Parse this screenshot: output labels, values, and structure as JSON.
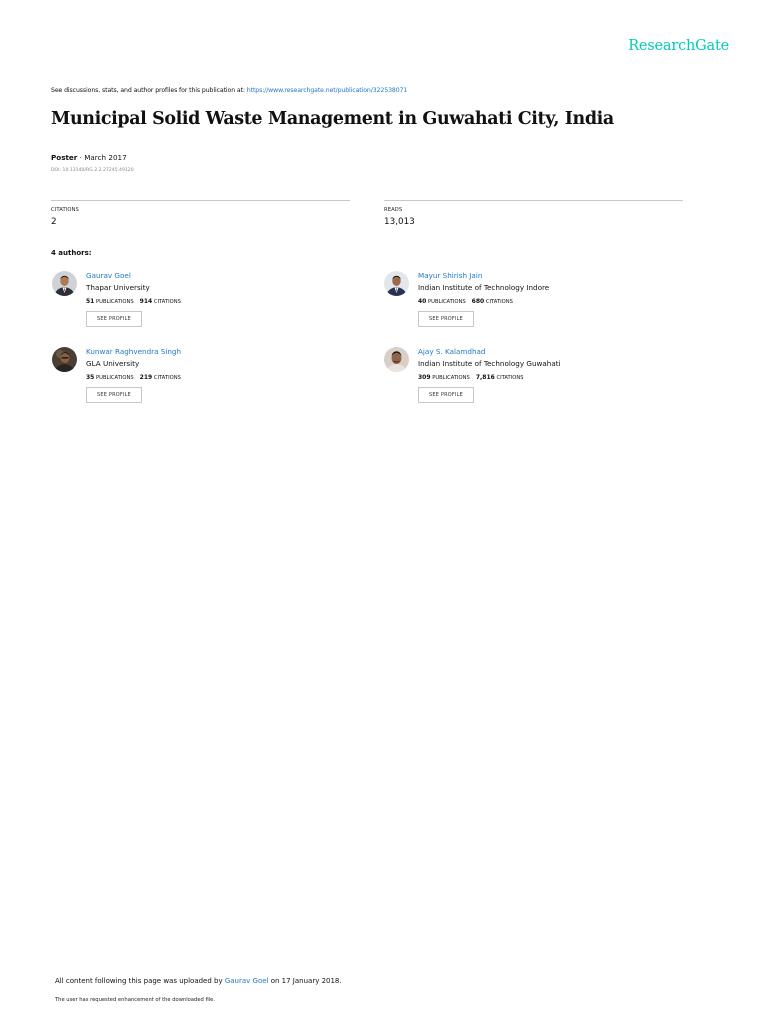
{
  "logo": "ResearchGate",
  "intro": {
    "text": "See discussions, stats, and author profiles for this publication at: ",
    "link": "https://www.researchgate.net/publication/322538071"
  },
  "publication": {
    "title": "Municipal Solid Waste Management in Guwahati City, India",
    "type": "Poster",
    "date": " · March 2017",
    "doi": "DOI: 10.13140/RG.2.2.27245.49120"
  },
  "stats": {
    "citations": {
      "label": "CITATIONS",
      "value": "2"
    },
    "reads": {
      "label": "READS",
      "value": "13,013"
    }
  },
  "authors_heading": "4 authors:",
  "authors": [
    {
      "name": "Gaurav Goel",
      "institution": "Thapar University",
      "publications": "51",
      "publications_label": "PUBLICATIONS",
      "citations": "914",
      "citations_label": "CITATIONS",
      "button": "SEE PROFILE"
    },
    {
      "name": "Mayur Shirish Jain",
      "institution": "Indian Institute of Technology Indore",
      "publications": "40",
      "publications_label": "PUBLICATIONS",
      "citations": "680",
      "citations_label": "CITATIONS",
      "button": "SEE PROFILE"
    },
    {
      "name": "Kunwar Raghvendra Singh",
      "institution": "GLA University",
      "publications": "35",
      "publications_label": "PUBLICATIONS",
      "citations": "219",
      "citations_label": "CITATIONS",
      "button": "SEE PROFILE"
    },
    {
      "name": "Ajay S. Kalamdhad",
      "institution": "Indian Institute of Technology Guwahati",
      "publications": "309",
      "publications_label": "PUBLICATIONS",
      "citations": "7,816",
      "citations_label": "CITATIONS",
      "button": "SEE PROFILE"
    }
  ],
  "footer": {
    "prefix": "All content following this page was uploaded by ",
    "uploader": "Gaurav Goel",
    "suffix": " on 17 January 2018.",
    "note": "The user has requested enhancement of the downloaded file."
  },
  "colors": {
    "brand": "#00ccbb",
    "link": "#1f78c8",
    "divider": "#c8c8c8"
  }
}
